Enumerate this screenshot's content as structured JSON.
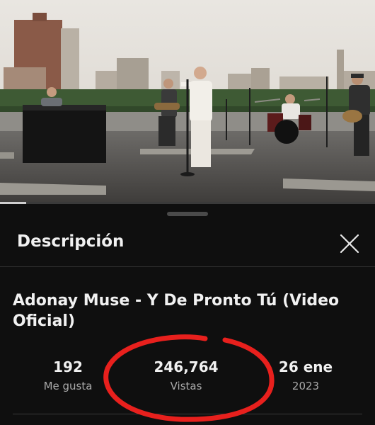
{
  "panel": {
    "heading": "Descripción",
    "close_icon": "close-icon"
  },
  "video": {
    "title": "Adonay Muse - Y De Pronto Tú (Video Oficial)",
    "progress_fraction": 0.07
  },
  "stats": {
    "likes": {
      "value": "192",
      "label": "Me gusta"
    },
    "views": {
      "value": "246,764",
      "label": "Vistas"
    },
    "date": {
      "value": "26 ene",
      "label": "2023"
    }
  },
  "annotation": {
    "color": "#e8201d"
  }
}
